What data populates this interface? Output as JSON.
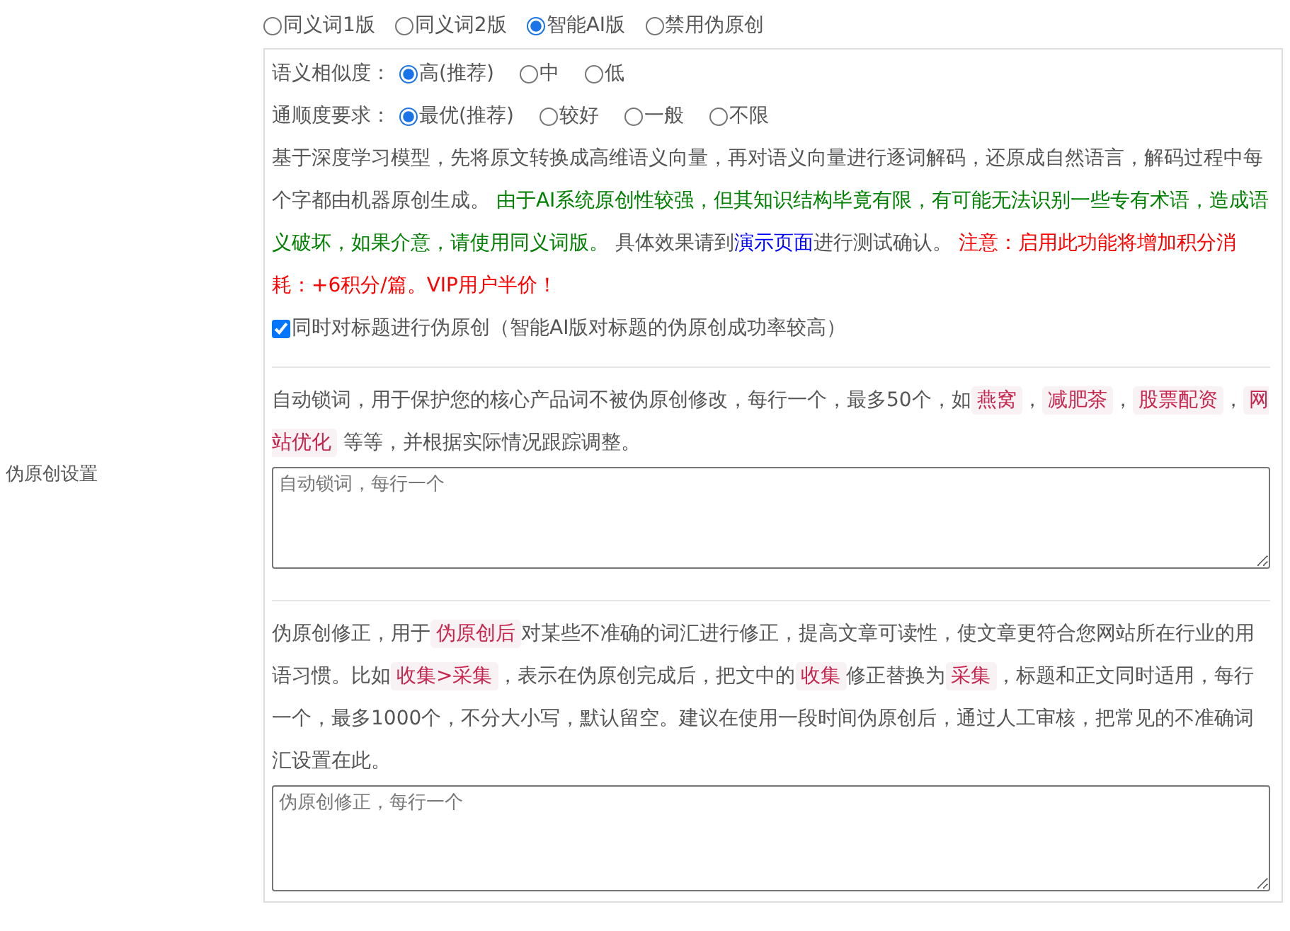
{
  "sidebar_label": "伪原创设置",
  "mode_options": [
    {
      "label": "同义词1版",
      "selected": false
    },
    {
      "label": "同义词2版",
      "selected": false
    },
    {
      "label": "智能AI版",
      "selected": true
    },
    {
      "label": "禁用伪原创",
      "selected": false
    }
  ],
  "ai_settings": {
    "similarity": {
      "label": "语义相似度：",
      "options": [
        {
          "label": "高(推荐)",
          "selected": true
        },
        {
          "label": "中",
          "selected": false
        },
        {
          "label": "低",
          "selected": false
        }
      ]
    },
    "fluency": {
      "label": "通顺度要求：",
      "options": [
        {
          "label": "最优(推荐)",
          "selected": true
        },
        {
          "label": "较好",
          "selected": false
        },
        {
          "label": "一般",
          "selected": false
        },
        {
          "label": "不限",
          "selected": false
        }
      ]
    },
    "description": [
      {
        "kind": "plain",
        "text": "基于深度学习模型，先将原文转换成高维语义向量，再对语义向量进行逐词解码，还原成自然语言，解码过程中每个字都由机器原创生成。 "
      },
      {
        "kind": "notice",
        "text": "由于AI系统原创性较强，但其知识结构毕竟有限，有可能无法识别一些专有术语，造成语义破坏，如果介意，请使用同义词版。"
      },
      {
        "kind": "plain",
        "text": " 具体效果请到"
      },
      {
        "kind": "link",
        "text": "演示页面"
      },
      {
        "kind": "plain",
        "text": "进行测试确认。 "
      },
      {
        "kind": "warning",
        "text": "注意：启用此功能将增加积分消耗：+6积分/篇。VIP用户半价！"
      }
    ],
    "title_option": {
      "label": "同时对标题进行伪原创（智能AI版对标题的伪原创成功率较高）",
      "checked": true
    }
  },
  "lock_words": {
    "description": [
      {
        "kind": "plain",
        "text": "自动锁词，用于保护您的核心产品词不被伪原创修改，每行一个，最多50个，如"
      },
      {
        "kind": "code",
        "text": "燕窝"
      },
      {
        "kind": "plain",
        "text": "，"
      },
      {
        "kind": "code",
        "text": "减肥茶"
      },
      {
        "kind": "plain",
        "text": "，"
      },
      {
        "kind": "code",
        "text": "股票配资"
      },
      {
        "kind": "plain",
        "text": "，"
      },
      {
        "kind": "code",
        "text": "网站优化"
      },
      {
        "kind": "plain",
        "text": " 等等，并根据实际情况跟踪调整。"
      }
    ],
    "placeholder": "自动锁词，每行一个"
  },
  "corrections": {
    "description": [
      {
        "kind": "plain",
        "text": "伪原创修正，用于"
      },
      {
        "kind": "code",
        "text": "伪原创后"
      },
      {
        "kind": "plain",
        "text": "对某些不准确的词汇进行修正，提高文章可读性，使文章更符合您网站所在行业的用语习惯。比如"
      },
      {
        "kind": "code",
        "text": "收集>采集"
      },
      {
        "kind": "plain",
        "text": "，表示在伪原创完成后，把文中的"
      },
      {
        "kind": "code",
        "text": "收集"
      },
      {
        "kind": "plain",
        "text": "修正替换为"
      },
      {
        "kind": "code",
        "text": "采集"
      },
      {
        "kind": "plain",
        "text": "，标题和正文同时适用，每行一个，最多1000个，不分大小写，默认留空。建议在使用一段时间伪原创后，通过人工审核，把常见的不准确词汇设置在此。"
      }
    ],
    "placeholder": "伪原创修正，每行一个"
  }
}
